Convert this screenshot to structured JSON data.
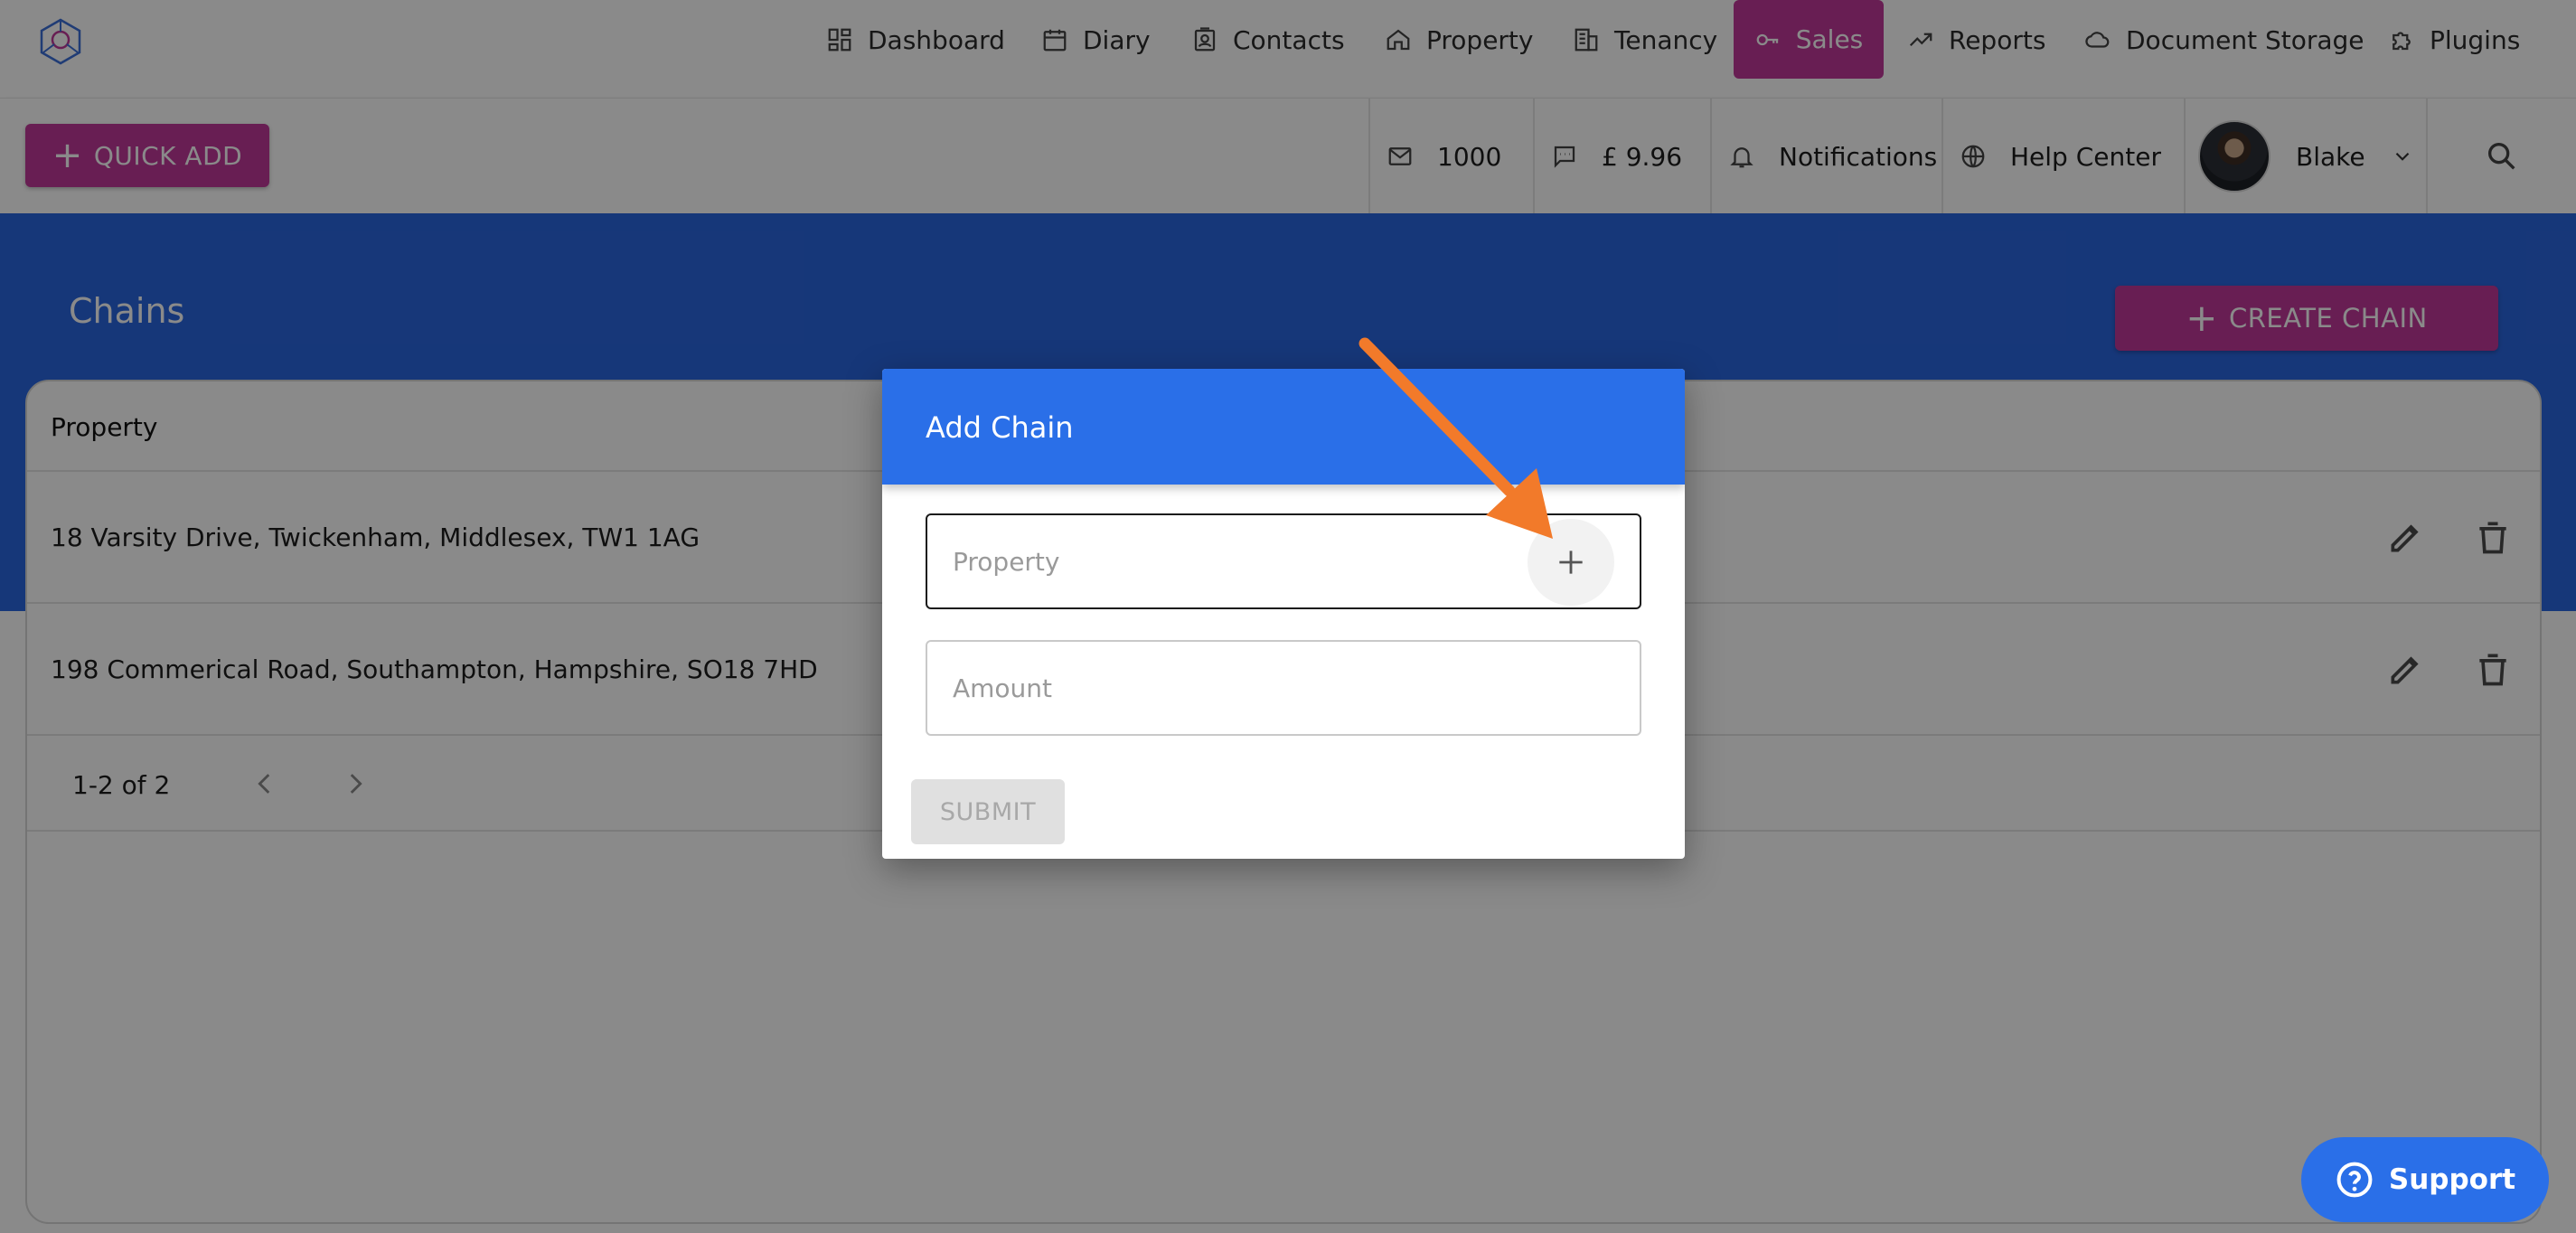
{
  "nav": {
    "items": [
      {
        "label": "Dashboard",
        "icon": "dashboard-icon"
      },
      {
        "label": "Diary",
        "icon": "calendar-icon"
      },
      {
        "label": "Contacts",
        "icon": "contacts-icon"
      },
      {
        "label": "Property",
        "icon": "home-icon"
      },
      {
        "label": "Tenancy",
        "icon": "building-icon"
      },
      {
        "label": "Sales",
        "icon": "key-icon",
        "active": true
      },
      {
        "label": "Reports",
        "icon": "trending-icon"
      },
      {
        "label": "Document Storage",
        "icon": "cloud-icon"
      },
      {
        "label": "Plugins",
        "icon": "puzzle-icon"
      }
    ]
  },
  "toolbar": {
    "quick_add_label": "QUICK ADD",
    "sms_count": "1000",
    "credit": "£ 9.96",
    "notifications_label": "Notifications",
    "help_label": "Help Center",
    "user_name": "Blake"
  },
  "page": {
    "title": "Chains",
    "create_label": "CREATE CHAIN"
  },
  "table": {
    "column_header": "Property",
    "rows": [
      {
        "property": "18 Varsity Drive, Twickenham, Middlesex, TW1 1AG"
      },
      {
        "property": "198 Commerical Road, Southampton, Hampshire, SO18 7HD"
      }
    ],
    "pagination": "1-2 of 2"
  },
  "modal": {
    "title": "Add Chain",
    "property_placeholder": "Property",
    "amount_placeholder": "Amount",
    "submit_label": "SUBMIT"
  },
  "support": {
    "label": "Support"
  },
  "colors": {
    "brand_magenta": "#c0399a",
    "primary_blue": "#2a6fe8",
    "annotation_arrow": "#f27a2a"
  }
}
